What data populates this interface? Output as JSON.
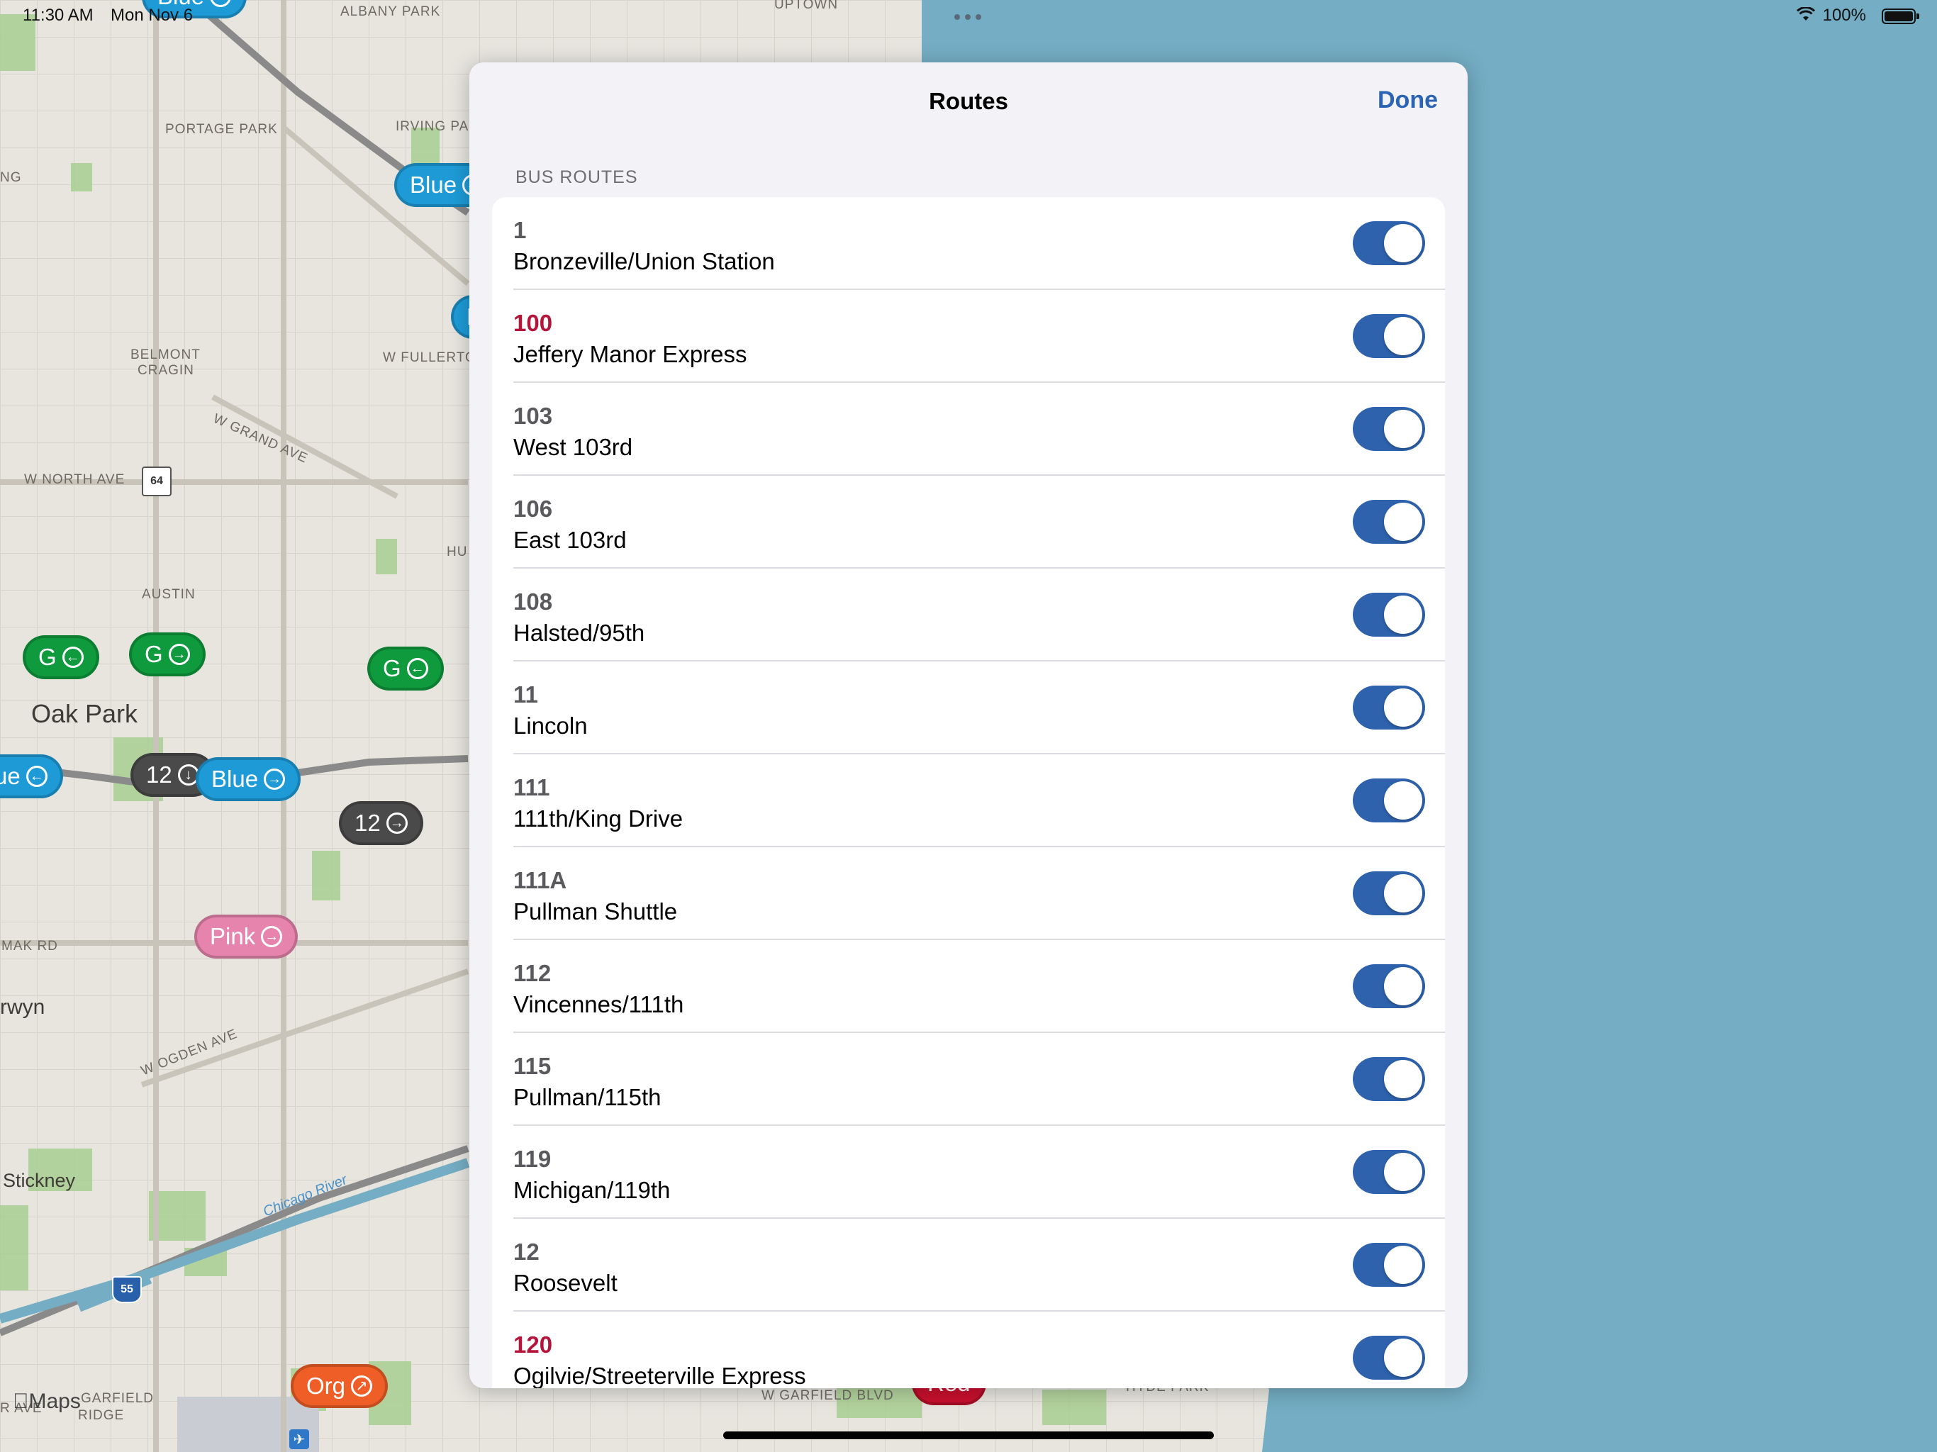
{
  "status_bar": {
    "time": "11:30 AM",
    "date": "Mon Nov 6",
    "battery": "100%",
    "wifi_icon": "wifi-icon",
    "battery_icon": "battery-icon"
  },
  "map": {
    "labels": {
      "albany_park": "ALBANY PARK",
      "uptown": "UPTOWN",
      "portage_park": "PORTAGE PARK",
      "irving_park": "IRVING PAR",
      "ng": "NG",
      "belmont": "BELMONT",
      "cragin": "CRAGIN",
      "fullerton": "W FULLERTO",
      "grand_ave": "W GRAND AVE",
      "north_ave": "W NORTH AVE",
      "hu": "HU",
      "austin": "AUSTIN",
      "oak_park": "Oak Park",
      "mak_rd": "MAK RD",
      "berwyn": "rwyn",
      "ogden_ave": "W OGDEN AVE",
      "stickney": "Stickney",
      "chicago_river": "Chicago River",
      "garfield_ridge_1": "GARFIELD",
      "garfield_ridge_2": "RIDGE",
      "r_ave": "R AVE",
      "garfield_blvd": "W GARFIELD BLVD",
      "hyde_park": "HYDE PARK",
      "maps_logo": "Maps",
      "route_64": "64",
      "route_55": "55"
    },
    "badges": {
      "blue_top": "Blue",
      "blue_mid": "Blue",
      "blue_partial": "B",
      "g_left": "G",
      "g_mid": "G",
      "g_right": "G",
      "ue_left": "ue",
      "twelve_a": "12",
      "blue_center": "Blue",
      "twelve_b": "12",
      "pink": "Pink",
      "org": "Org",
      "red": "Red"
    },
    "colors": {
      "blue_line": "#1e9bd7",
      "green_line": "#0f9a3d",
      "pink_line": "#e684ad",
      "orange_line": "#ef5e27",
      "red_line": "#c8102e",
      "bus": "#4a4a4a",
      "water": "#74adc4"
    }
  },
  "sheet": {
    "title": "Routes",
    "done_label": "Done",
    "section_header": "BUS ROUTES",
    "routes": [
      {
        "number": "1",
        "name": "Bronzeville/Union Station",
        "express": false,
        "enabled": true
      },
      {
        "number": "100",
        "name": "Jeffery Manor Express",
        "express": true,
        "enabled": true
      },
      {
        "number": "103",
        "name": "West 103rd",
        "express": false,
        "enabled": true
      },
      {
        "number": "106",
        "name": "East 103rd",
        "express": false,
        "enabled": true
      },
      {
        "number": "108",
        "name": "Halsted/95th",
        "express": false,
        "enabled": true
      },
      {
        "number": "11",
        "name": "Lincoln",
        "express": false,
        "enabled": true
      },
      {
        "number": "111",
        "name": "111th/King Drive",
        "express": false,
        "enabled": true
      },
      {
        "number": "111A",
        "name": "Pullman Shuttle",
        "express": false,
        "enabled": true
      },
      {
        "number": "112",
        "name": "Vincennes/111th",
        "express": false,
        "enabled": true
      },
      {
        "number": "115",
        "name": "Pullman/115th",
        "express": false,
        "enabled": true
      },
      {
        "number": "119",
        "name": "Michigan/119th",
        "express": false,
        "enabled": true
      },
      {
        "number": "12",
        "name": "Roosevelt",
        "express": false,
        "enabled": true
      },
      {
        "number": "120",
        "name": "Ogilvie/Streeterville Express",
        "express": true,
        "enabled": true
      }
    ],
    "colors": {
      "accent": "#2b64b3",
      "toggle_on": "#2e62ad",
      "express_number": "#b3153b"
    }
  }
}
